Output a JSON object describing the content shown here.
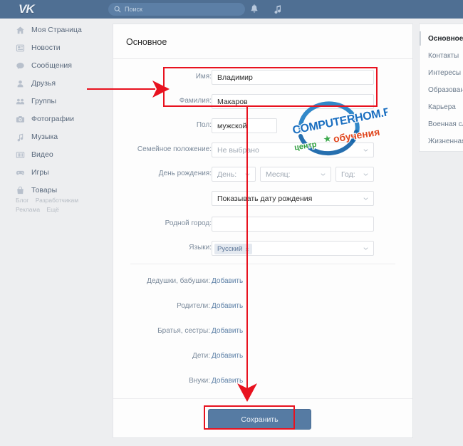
{
  "topbar": {
    "logo": "VK",
    "search_placeholder": "Поиск",
    "icons": [
      {
        "name": "search-icon"
      },
      {
        "name": "bell-icon"
      },
      {
        "name": "music-note-icon"
      }
    ]
  },
  "sidebar": {
    "items": [
      {
        "label": "Моя Страница",
        "icon": "home-icon"
      },
      {
        "label": "Новости",
        "icon": "news-icon"
      },
      {
        "label": "Сообщения",
        "icon": "message-icon"
      },
      {
        "label": "Друзья",
        "icon": "person-icon"
      },
      {
        "label": "Группы",
        "icon": "people-icon"
      },
      {
        "label": "Фотографии",
        "icon": "camera-icon"
      },
      {
        "label": "Музыка",
        "icon": "music-note-icon"
      },
      {
        "label": "Видео",
        "icon": "video-icon"
      },
      {
        "label": "Игры",
        "icon": "gamepad-icon"
      },
      {
        "label": "Товары",
        "icon": "bag-icon"
      }
    ],
    "footer": [
      "Блог",
      "Разработчикам",
      "Реклама",
      "Ещё"
    ]
  },
  "main": {
    "title": "Основное",
    "fields": [
      {
        "label": "Имя:",
        "value": "Владимир",
        "type": "text",
        "placeholder": ""
      },
      {
        "label": "Фамилия:",
        "value": "Макаров",
        "type": "text",
        "placeholder": ""
      },
      {
        "label": "Пол:",
        "value": "мужской",
        "type": "text",
        "placeholder": ""
      },
      {
        "label": "Семейное положение:",
        "value": "Не выбрано",
        "type": "select",
        "placeholder": "Не выбрано"
      }
    ],
    "birthday": {
      "label": "День рождения:",
      "day": "День:",
      "month": "Месяц:",
      "year": "Год:",
      "visibility": "Показывать дату рождения"
    },
    "hometown": {
      "label": "Родной город:",
      "value": "",
      "placeholder": ""
    },
    "languages": {
      "label": "Языки:",
      "chip": "Русский",
      "chip_remove": "×"
    },
    "relatives": [
      {
        "label": "Дедушки, бабушки:",
        "action": "Добавить"
      },
      {
        "label": "Родители:",
        "action": "Добавить"
      },
      {
        "label": "Братья, сестры:",
        "action": "Добавить"
      },
      {
        "label": "Дети:",
        "action": "Добавить"
      },
      {
        "label": "Внуки:",
        "action": "Добавить"
      }
    ],
    "save_label": "Сохранить"
  },
  "right_tabs": [
    {
      "label": "Основное",
      "active": true
    },
    {
      "label": "Контакты",
      "active": false
    },
    {
      "label": "Интересы",
      "active": false
    },
    {
      "label": "Образование",
      "active": false
    },
    {
      "label": "Карьера",
      "active": false
    },
    {
      "label": "Военная служба",
      "active": false
    },
    {
      "label": "Жизненная позиция",
      "active": false
    }
  ],
  "watermark": {
    "line1": "COMPUTERHOM.RU",
    "line2": "центр",
    "line3": "обучения"
  },
  "annotation": {
    "color": "#e8121f",
    "highlight_fields": [
      "Имя:",
      "Фамилия:"
    ],
    "highlight_button": "Сохранить"
  }
}
